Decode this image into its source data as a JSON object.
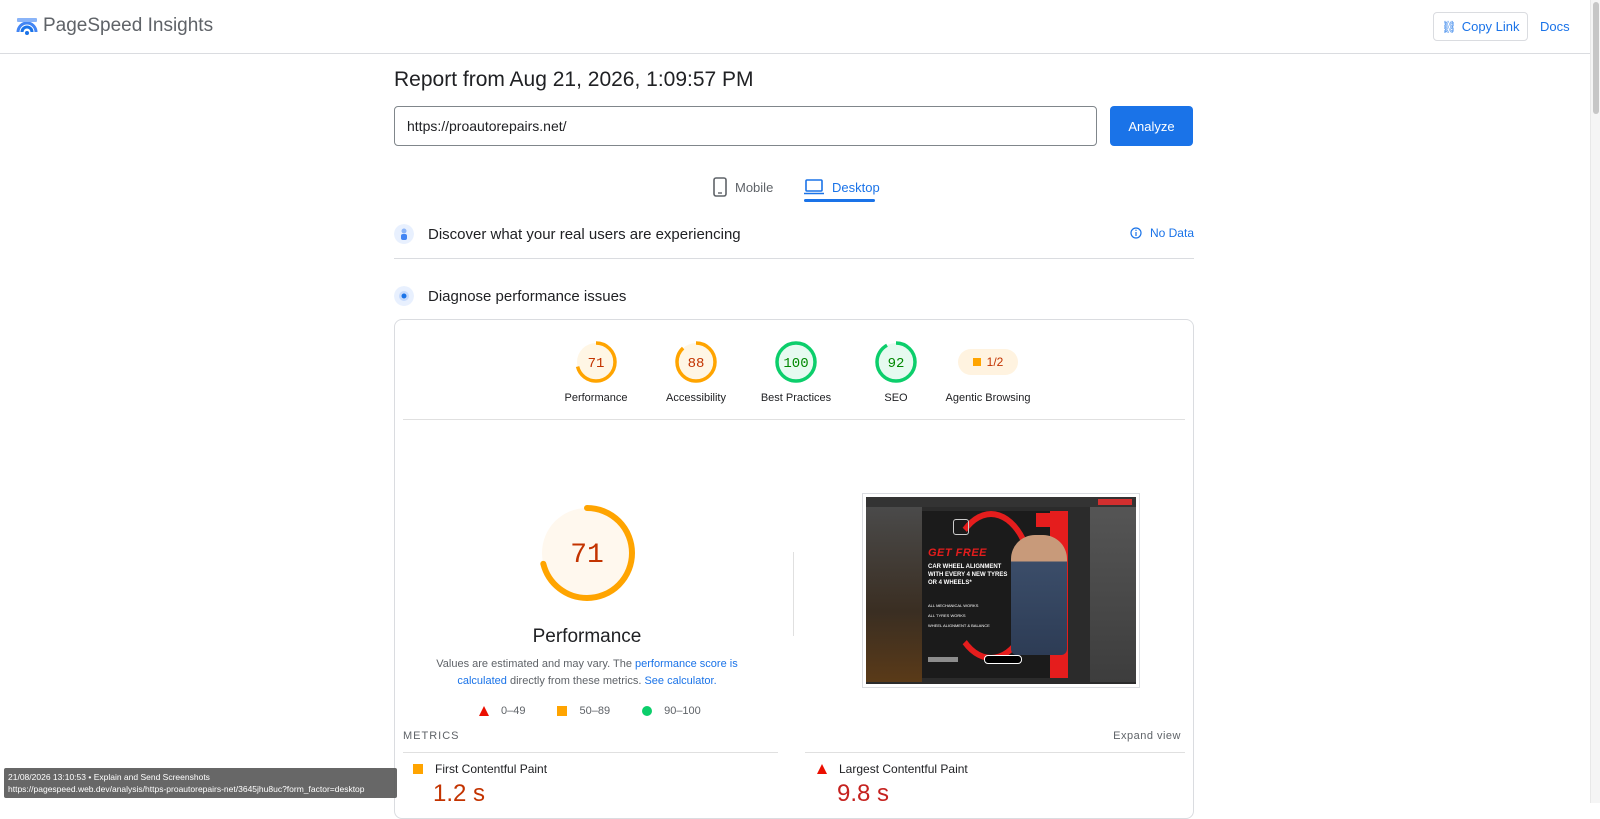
{
  "header": {
    "brand": "PageSpeed Insights",
    "copy_link": "Copy Link",
    "docs": "Docs"
  },
  "report": {
    "title": "Report from Aug 21, 2026, 1:09:57 PM",
    "url_value": "https://proautorepairs.net/",
    "analyze": "Analyze"
  },
  "tabs": {
    "mobile": "Mobile",
    "desktop": "Desktop",
    "active": "Desktop"
  },
  "real_users": {
    "title": "Discover what your real users are experiencing",
    "status": "No Data"
  },
  "diagnose": {
    "title": "Diagnose performance issues"
  },
  "scores": [
    {
      "label": "Performance",
      "value": "71",
      "score": 71,
      "color": "#ffa400",
      "text_color": "#c33300"
    },
    {
      "label": "Accessibility",
      "value": "88",
      "score": 88,
      "color": "#ffa400",
      "text_color": "#c33300"
    },
    {
      "label": "Best Practices",
      "value": "100",
      "score": 100,
      "color": "#0cce6b",
      "text_color": "#008800"
    },
    {
      "label": "SEO",
      "value": "92",
      "score": 92,
      "color": "#0cce6b",
      "text_color": "#008800"
    }
  ],
  "agentic": {
    "label": "Agentic Browsing",
    "value": "1/2"
  },
  "performance": {
    "score": "71",
    "score_num": 71,
    "title": "Performance",
    "desc_1": "Values are estimated and may vary. The ",
    "link_1": "performance score is calculated",
    "desc_2": " directly from these metrics. ",
    "link_2": "See calculator.",
    "legend": [
      "0–49",
      "50–89",
      "90–100"
    ]
  },
  "screenshot_text": {
    "get_free": "GET FREE",
    "headline": "CAR WHEEL ALIGNMENT WITH EVERY 4 NEW TYRES OR 4 WHEELS*",
    "list": [
      "ALL MECHANICAL WORKS",
      "ALL TYRES WORKS",
      "WHEEL ALIGNMENT & BALANCE"
    ]
  },
  "metrics": {
    "label": "METRICS",
    "expand": "Expand view",
    "fcp": {
      "name": "First Contentful Paint",
      "value": "1.2 s"
    },
    "lcp": {
      "name": "Largest Contentful Paint",
      "value": "9.8 s"
    }
  },
  "status_tip": {
    "line1": "21/08/2026 13:10:53 • Explain and Send Screenshots",
    "line2": "https://pagespeed.web.dev/analysis/https-proautorepairs-net/3645jhu8uc?form_factor=desktop"
  },
  "colors": {
    "accent": "#1a73e8",
    "average": "#ffa400",
    "pass": "#0cce6b",
    "fail": "#eb0f00"
  }
}
